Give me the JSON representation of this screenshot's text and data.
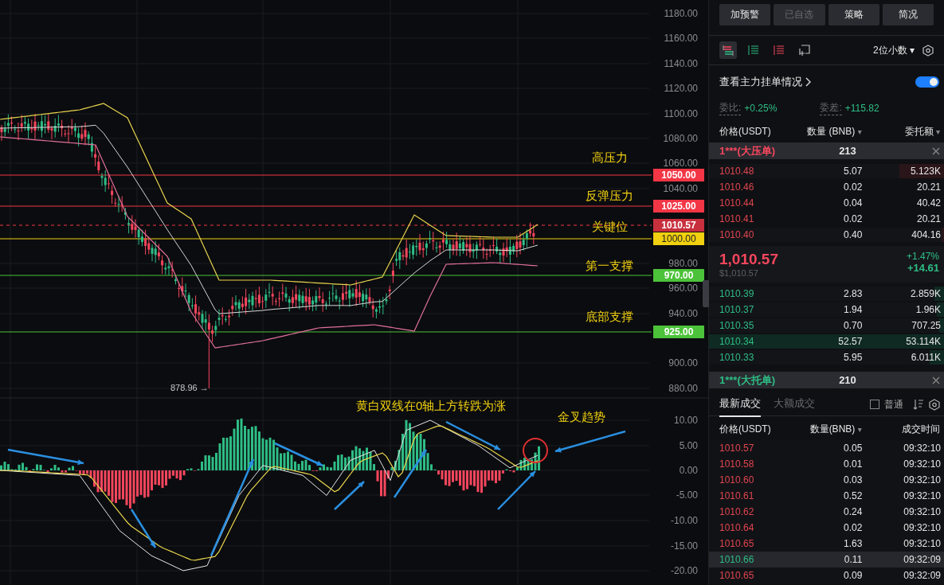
{
  "chart": {
    "price_ticks": [
      "1180.00",
      "1160.00",
      "1140.00",
      "1120.00",
      "1100.00",
      "1080.00",
      "1060.00",
      "1040.00",
      "980.00",
      "960.00",
      "940.00",
      "900.00",
      "880.00"
    ],
    "levels": [
      {
        "label": "高压力",
        "price": "1050.00",
        "color": "#f23645"
      },
      {
        "label": "反弹压力",
        "price": "1025.00",
        "color": "#f23645"
      },
      {
        "label": "关键位",
        "price": "1000.00",
        "color": "#f0d010"
      },
      {
        "label": "第一支撑",
        "price": "970.00",
        "color": "#4cc23a"
      },
      {
        "label": "底部支撑",
        "price": "925.00",
        "color": "#4cc23a"
      }
    ],
    "current_price": "1010.57",
    "low_marker": "878.96 →",
    "macd_ticks": [
      "10.00",
      "5.00",
      "0.00",
      "-5.00",
      "-10.00",
      "-15.00",
      "-20.00"
    ],
    "annotations": [
      "黄白双线在0轴上方转跌为涨",
      "金叉趋势"
    ]
  },
  "panel": {
    "buttons": [
      {
        "label": "加预警",
        "disabled": false
      },
      {
        "label": "已自选",
        "disabled": true
      },
      {
        "label": "策略",
        "disabled": false
      },
      {
        "label": "简况",
        "disabled": false
      }
    ],
    "views": [
      {
        "kind": "both",
        "selected": true
      },
      {
        "kind": "bids",
        "selected": false
      },
      {
        "kind": "asks",
        "selected": false
      },
      {
        "kind": "add",
        "selected": false
      }
    ],
    "decimals": {
      "label": "2位小数",
      "caret": "▾"
    },
    "main_orders": {
      "label": "查看主力挂单情况",
      "on": true
    },
    "ratio": {
      "label": "委比:",
      "value": "+0.25%"
    },
    "diff": {
      "label": "委差:",
      "value": "+115.82"
    },
    "columns": [
      {
        "label": "价格(USDT)"
      },
      {
        "label": "数量 (BNB)",
        "caret": "▾"
      },
      {
        "label": "委托额",
        "caret": "▾"
      }
    ],
    "ask_banner": {
      "label": "1***(大压单)",
      "value": "213"
    },
    "asks": [
      {
        "price": "1010.48",
        "qty": "5.07",
        "amount": "5.123K",
        "level": 0.19
      },
      {
        "price": "1010.46",
        "qty": "0.02",
        "amount": "20.21"
      },
      {
        "price": "1010.44",
        "qty": "0.04",
        "amount": "40.42"
      },
      {
        "price": "1010.41",
        "qty": "0.02",
        "amount": "20.21"
      },
      {
        "price": "1010.40",
        "qty": "0.40",
        "amount": "404.16",
        "level": 0.01
      }
    ],
    "last": {
      "price": "1,010.57",
      "usd": "$1,010.57",
      "pct": "+1.47%",
      "change": "+14.61"
    },
    "bids": [
      {
        "price": "1010.39",
        "qty": "2.83",
        "amount": "2.859K",
        "level": 0.04
      },
      {
        "price": "1010.37",
        "qty": "1.94",
        "amount": "1.96K",
        "level": 0.03
      },
      {
        "price": "1010.35",
        "qty": "0.70",
        "amount": "707.25",
        "level": 0.02
      },
      {
        "price": "1010.34",
        "qty": "52.57",
        "amount": "53.114K",
        "level": 1
      },
      {
        "price": "1010.33",
        "qty": "5.95",
        "amount": "6.011K",
        "level": 0.06
      }
    ],
    "bid_banner": {
      "label": "1***(大托单)",
      "value": "210"
    },
    "trade_tabs": [
      {
        "label": "最新成交",
        "selected": true
      },
      {
        "label": "大额成交",
        "selected": false
      }
    ],
    "normal_filter": {
      "label": "普通",
      "checked": false
    },
    "trade_columns": [
      {
        "label": "价格(USDT)"
      },
      {
        "label": "数量(BNB)",
        "caret": "▾"
      },
      {
        "label": "成交时间"
      }
    ],
    "trades": [
      {
        "price": "1010.57",
        "qty": "0.05",
        "time": "09:32:10",
        "color": "#e0454f",
        "highlighted": false
      },
      {
        "price": "1010.58",
        "qty": "0.01",
        "time": "09:32:10",
        "color": "#e0454f",
        "highlighted": false
      },
      {
        "price": "1010.60",
        "qty": "0.03",
        "time": "09:32:10",
        "color": "#e0454f",
        "highlighted": false
      },
      {
        "price": "1010.61",
        "qty": "0.52",
        "time": "09:32:10",
        "color": "#e0454f",
        "highlighted": false
      },
      {
        "price": "1010.62",
        "qty": "0.24",
        "time": "09:32:10",
        "color": "#e0454f",
        "highlighted": false
      },
      {
        "price": "1010.64",
        "qty": "0.02",
        "time": "09:32:10",
        "color": "#e0454f",
        "highlighted": false
      },
      {
        "price": "1010.65",
        "qty": "1.63",
        "time": "09:32:10",
        "color": "#e0454f",
        "highlighted": false
      },
      {
        "price": "1010.66",
        "qty": "0.11",
        "time": "09:32:09",
        "color": "#2ebd85",
        "highlighted": true
      },
      {
        "price": "1010.65",
        "qty": "0.09",
        "time": "09:32:09",
        "color": "#e0454f",
        "highlighted": false
      }
    ]
  }
}
